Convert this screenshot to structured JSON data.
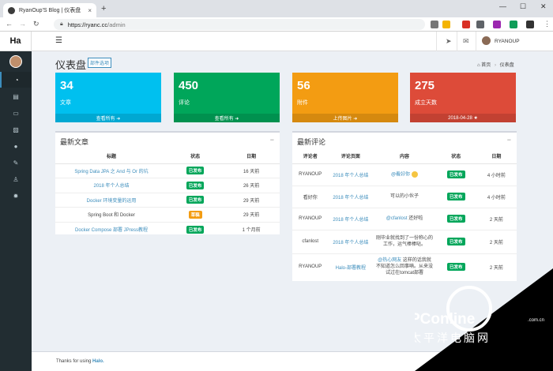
{
  "browser": {
    "tab_title": "RyanOup'S Blog | 仪表盘",
    "tab_close": "×",
    "new_tab": "+",
    "url_host": "https://ryanc.cc",
    "url_path": "/admin",
    "minimize": "—",
    "maximize": "☐",
    "close": "✕",
    "back": "←",
    "forward": "→",
    "reload": "↻",
    "menu": "⋮"
  },
  "header": {
    "logo": "Ha",
    "toggle": "☰",
    "user": "RYANOUP"
  },
  "page": {
    "title": "仪表盘",
    "options": "部件选项",
    "breadcrumb_home": "首页",
    "breadcrumb_current": "仪表盘"
  },
  "cards": [
    {
      "value": "34",
      "label": "文章",
      "footer": "查看所有 ➜",
      "color": "#00c0ef"
    },
    {
      "value": "450",
      "label": "评论",
      "footer": "查看所有 ➜",
      "color": "#00a65a"
    },
    {
      "value": "56",
      "label": "附件",
      "footer": "上传图片 ➜",
      "color": "#f39c12"
    },
    {
      "value": "275",
      "label": "成立天数",
      "footer": "2018-04-28 ★",
      "color": "#dd4b39"
    }
  ],
  "latest_posts": {
    "title": "最新文章",
    "minimize": "−",
    "headers": [
      "标题",
      "状态",
      "日期"
    ],
    "rows": [
      {
        "title": "Spring Data JPA 之 And 与 Or 的坑",
        "status": "已发布",
        "status_color": "#00a65a",
        "date": "16 天前",
        "link": true
      },
      {
        "title": "2018 年个人总结",
        "status": "已发布",
        "status_color": "#00a65a",
        "date": "26 天前",
        "link": true
      },
      {
        "title": "Docker 环境变量的运用",
        "status": "已发布",
        "status_color": "#00a65a",
        "date": "29 天前",
        "link": true
      },
      {
        "title": "Spring Boot 和 Docker",
        "status": "草稿",
        "status_color": "#f39c12",
        "date": "29 天前",
        "link": false
      },
      {
        "title": "Docker Compose 部署 JPress教程",
        "status": "已发布",
        "status_color": "#00a65a",
        "date": "1 个月前",
        "link": true
      }
    ]
  },
  "latest_comments": {
    "title": "最新评论",
    "minimize": "−",
    "headers": [
      "评论者",
      "评论页面",
      "内容",
      "状态",
      "日期"
    ],
    "rows": [
      {
        "author": "RYANOUP",
        "page": "2018 年个人总结",
        "content": "@看好你",
        "emoji": true,
        "status": "已发布",
        "date": "4 小时前"
      },
      {
        "author": "看好你",
        "page": "2018 年个人总结",
        "content": "可以的小伙子",
        "emoji": false,
        "status": "已发布",
        "date": "4 小时前"
      },
      {
        "author": "RYANOUP",
        "page": "2018 年个人总结",
        "content": "@cfanlost 还好啦",
        "emoji": false,
        "status": "已发布",
        "date": "2 天前"
      },
      {
        "author": "cfanlost",
        "page": "2018 年个人总结",
        "content": "刚毕业就找到了一份称心的工作，运气棒棒哒。",
        "emoji": false,
        "status": "已发布",
        "date": "2 天前"
      },
      {
        "author": "RYANOUP",
        "page": "Halo-部署教程",
        "content": "@热心网友 这样的话我就不知道怎么回事喃。从来没试过在tomcat部署",
        "emoji": false,
        "status": "已发布",
        "date": "2 天前"
      }
    ]
  },
  "footer": {
    "prefix": "Thanks for using ",
    "brand": "Halo."
  },
  "watermark": {
    "brand": "PConline",
    "site": ".com.cn",
    "cn": "太平洋电脑网"
  },
  "colors": {
    "sidebar": "#222d32",
    "link": "#3c8dbc",
    "success": "#00a65a",
    "warning": "#f39c12"
  }
}
